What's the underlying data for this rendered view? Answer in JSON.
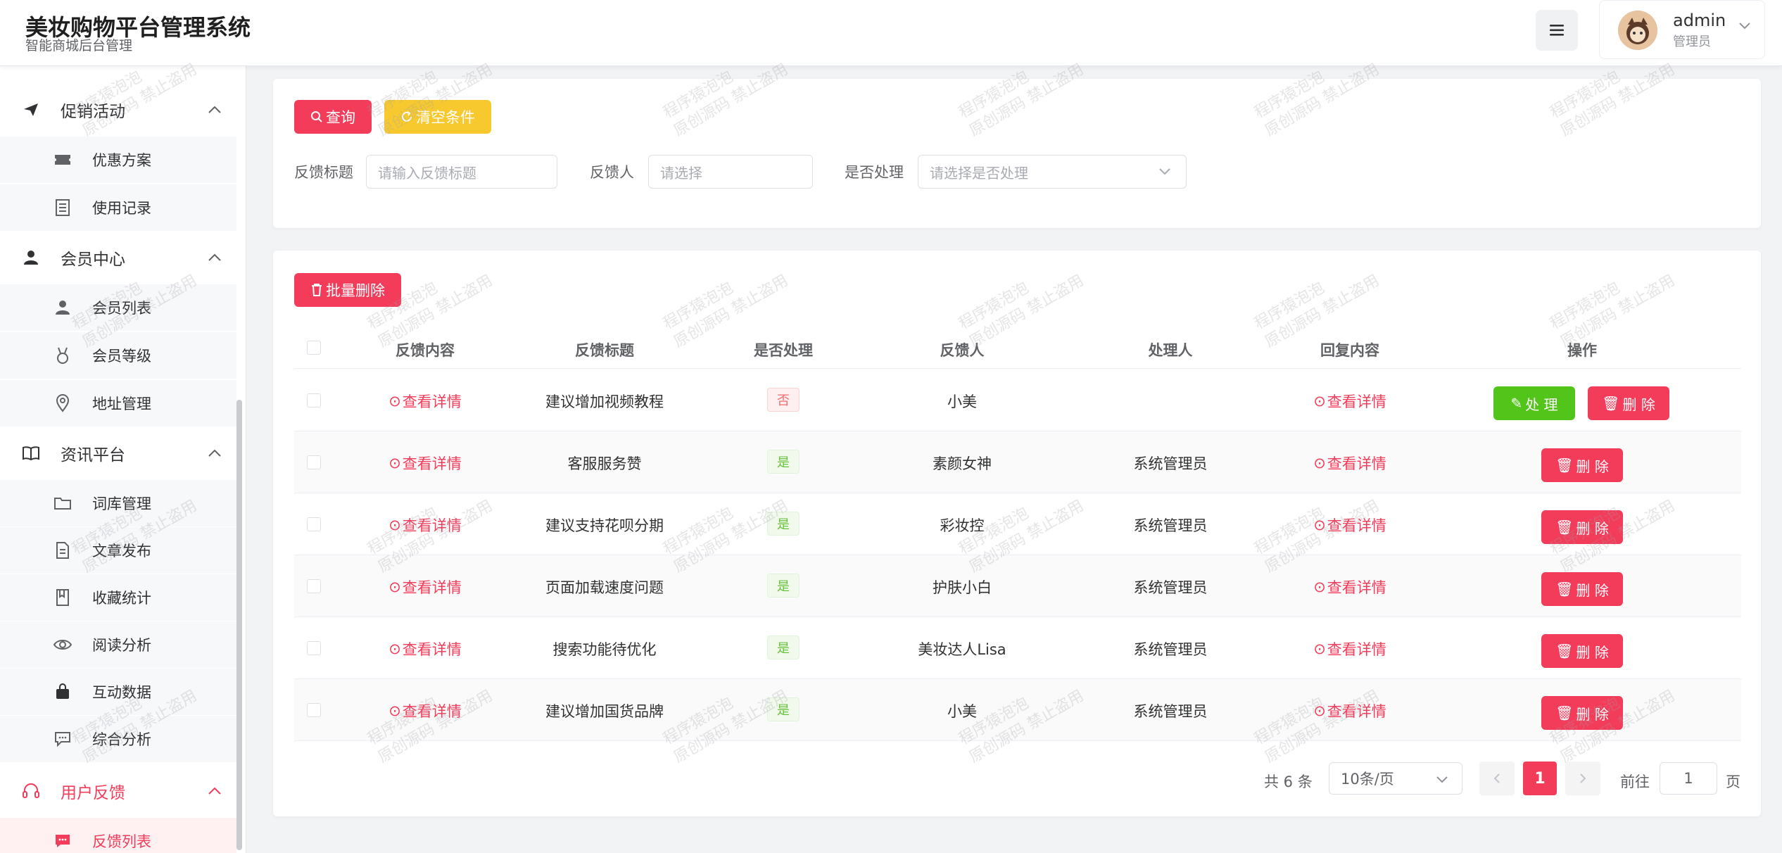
{
  "header": {
    "title": "美妆购物平台管理系统",
    "subtitle": "智能商城后台管理",
    "user": {
      "name": "admin",
      "role": "管理员"
    }
  },
  "sidebar": {
    "groups": [
      {
        "label": "促销活动",
        "icon": "send-icon",
        "items": [
          {
            "label": "优惠方案",
            "icon": "ticket-icon"
          },
          {
            "label": "使用记录",
            "icon": "record-icon"
          }
        ]
      },
      {
        "label": "会员中心",
        "icon": "user-icon",
        "items": [
          {
            "label": "会员列表",
            "icon": "user-list-icon"
          },
          {
            "label": "会员等级",
            "icon": "medal-icon"
          },
          {
            "label": "地址管理",
            "icon": "location-icon"
          }
        ]
      },
      {
        "label": "资讯平台",
        "icon": "book-icon",
        "items": [
          {
            "label": "词库管理",
            "icon": "folder-icon"
          },
          {
            "label": "文章发布",
            "icon": "document-icon"
          },
          {
            "label": "收藏统计",
            "icon": "bookmark-icon"
          },
          {
            "label": "阅读分析",
            "icon": "eye-icon"
          },
          {
            "label": "互动数据",
            "icon": "bag-icon"
          },
          {
            "label": "综合分析",
            "icon": "chat-icon"
          }
        ]
      },
      {
        "label": "用户反馈",
        "icon": "headset-icon",
        "items": [
          {
            "label": "反馈列表",
            "icon": "message-icon"
          }
        ]
      }
    ]
  },
  "filters": {
    "query_label": "查询",
    "clear_label": "清空条件",
    "title_label": "反馈标题",
    "title_placeholder": "请输入反馈标题",
    "person_label": "反馈人",
    "person_placeholder": "请选择",
    "handled_label": "是否处理",
    "handled_placeholder": "请选择是否处理"
  },
  "table": {
    "batch_delete_label": "批量删除",
    "columns": [
      "反馈内容",
      "反馈标题",
      "是否处理",
      "反馈人",
      "处理人",
      "回复内容",
      "操作"
    ],
    "view_label": "查看详情",
    "process_label": "处 理",
    "delete_label": "删 除",
    "rows": [
      {
        "title": "建议增加视频教程",
        "handled": "否",
        "person": "小美",
        "handler": "",
        "can_process": true
      },
      {
        "title": "客服服务赞",
        "handled": "是",
        "person": "素颜女神",
        "handler": "系统管理员",
        "can_process": false
      },
      {
        "title": "建议支持花呗分期",
        "handled": "是",
        "person": "彩妆控",
        "handler": "系统管理员",
        "can_process": false
      },
      {
        "title": "页面加载速度问题",
        "handled": "是",
        "person": "护肤小白",
        "handler": "系统管理员",
        "can_process": false
      },
      {
        "title": "搜索功能待优化",
        "handled": "是",
        "person": "美妆达人Lisa",
        "handler": "系统管理员",
        "can_process": false
      },
      {
        "title": "建议增加国货品牌",
        "handled": "是",
        "person": "小美",
        "handler": "系统管理员",
        "can_process": false
      }
    ]
  },
  "pagination": {
    "total_text": "共 6 条",
    "page_size": "10条/页",
    "current_page": "1",
    "goto_prefix": "前往",
    "goto_value": "1",
    "goto_suffix": "页"
  },
  "watermark": {
    "line1": "程序猿泡泡",
    "line2": "原创源码 禁止盗用"
  },
  "colors": {
    "primary": "#f23c5a",
    "warning": "#f7c92f",
    "success": "#52c41a"
  }
}
